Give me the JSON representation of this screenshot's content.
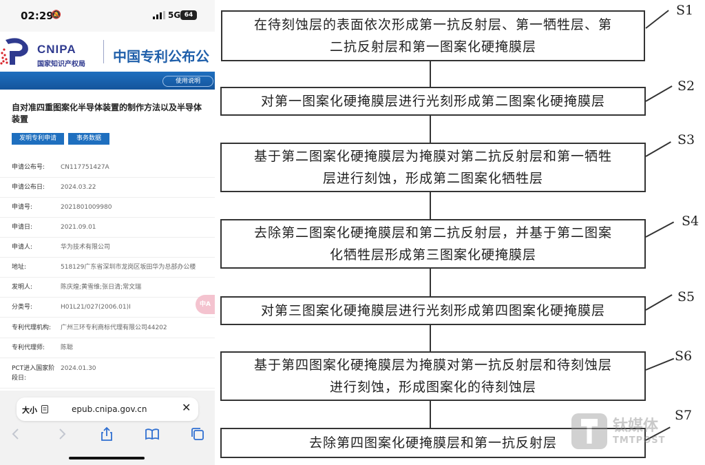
{
  "phone": {
    "status_bar": {
      "time": "02:29",
      "network": "5G",
      "battery": "64"
    },
    "header": {
      "logo_en": "CNIPA",
      "logo_cn": "国家知识产权局",
      "site_title": "中国专利公布公"
    },
    "help_label": "使用说明",
    "patent_title": "自对准四重图案化半导体装置的制作方法以及半导体装置",
    "tabs": [
      "发明专利申请",
      "事务数据"
    ],
    "fields": [
      {
        "key": "申请公布号:",
        "value": "CN117751427A"
      },
      {
        "key": "申请公布日:",
        "value": "2024.03.22"
      },
      {
        "key": "申请号:",
        "value": "2021801009980"
      },
      {
        "key": "申请日:",
        "value": "2021.09.01"
      },
      {
        "key": "申请人:",
        "value": "华为技术有限公司"
      },
      {
        "key": "地址:",
        "value": "518129广东省深圳市龙岗区坂田华为总部办公楼"
      },
      {
        "key": "发明人:",
        "value": "陈庆煌;黄雪维;张日清;常文瑞"
      },
      {
        "key": "分类号:",
        "value": "H01L21/027(2006.01)I"
      },
      {
        "key": "专利代理机构:",
        "value": "广州三环专利商标代理有限公司44202"
      },
      {
        "key": "专利代理师:",
        "value": "陈聪"
      },
      {
        "key": "PCT进入国家阶段日:",
        "value": "2024.01.30"
      }
    ],
    "translate_label": "中A",
    "browser": {
      "text_size_label": "大小",
      "url": "epub.cnipa.gov.cn",
      "close_label": "✕"
    }
  },
  "diagram": {
    "steps": [
      {
        "label": "S1",
        "lines": [
          "在待刻蚀层的表面依次形成第一抗反射层、第一牺牲层、第",
          "二抗反射层和第一图案化硬掩膜层"
        ]
      },
      {
        "label": "S2",
        "lines": [
          "对第一图案化硬掩膜层进行光刻形成第二图案化硬掩膜层"
        ]
      },
      {
        "label": "S3",
        "lines": [
          "基于第二图案化硬掩膜层为掩膜对第二抗反射层和第一牺牲",
          "层进行刻蚀，形成第二图案化牺牲层"
        ]
      },
      {
        "label": "S4",
        "lines": [
          "去除第二图案化硬掩膜层和第二抗反射层，并基于第二图案",
          "化牺牲层形成第三图案化硬掩膜层"
        ]
      },
      {
        "label": "S5",
        "lines": [
          "对第三图案化硬掩膜层进行光刻形成第四图案化硬掩膜层"
        ]
      },
      {
        "label": "S6",
        "lines": [
          "基于第四图案化硬掩膜层为掩膜对第一抗反射层和待刻蚀层",
          "进行刻蚀，形成图案化的待刻蚀层"
        ]
      },
      {
        "label": "S7",
        "lines": [
          "去除第四图案化硬掩膜层和第一抗反射层"
        ]
      }
    ]
  },
  "watermark": {
    "cn": "钛媒体",
    "en": "TMTPOST"
  }
}
